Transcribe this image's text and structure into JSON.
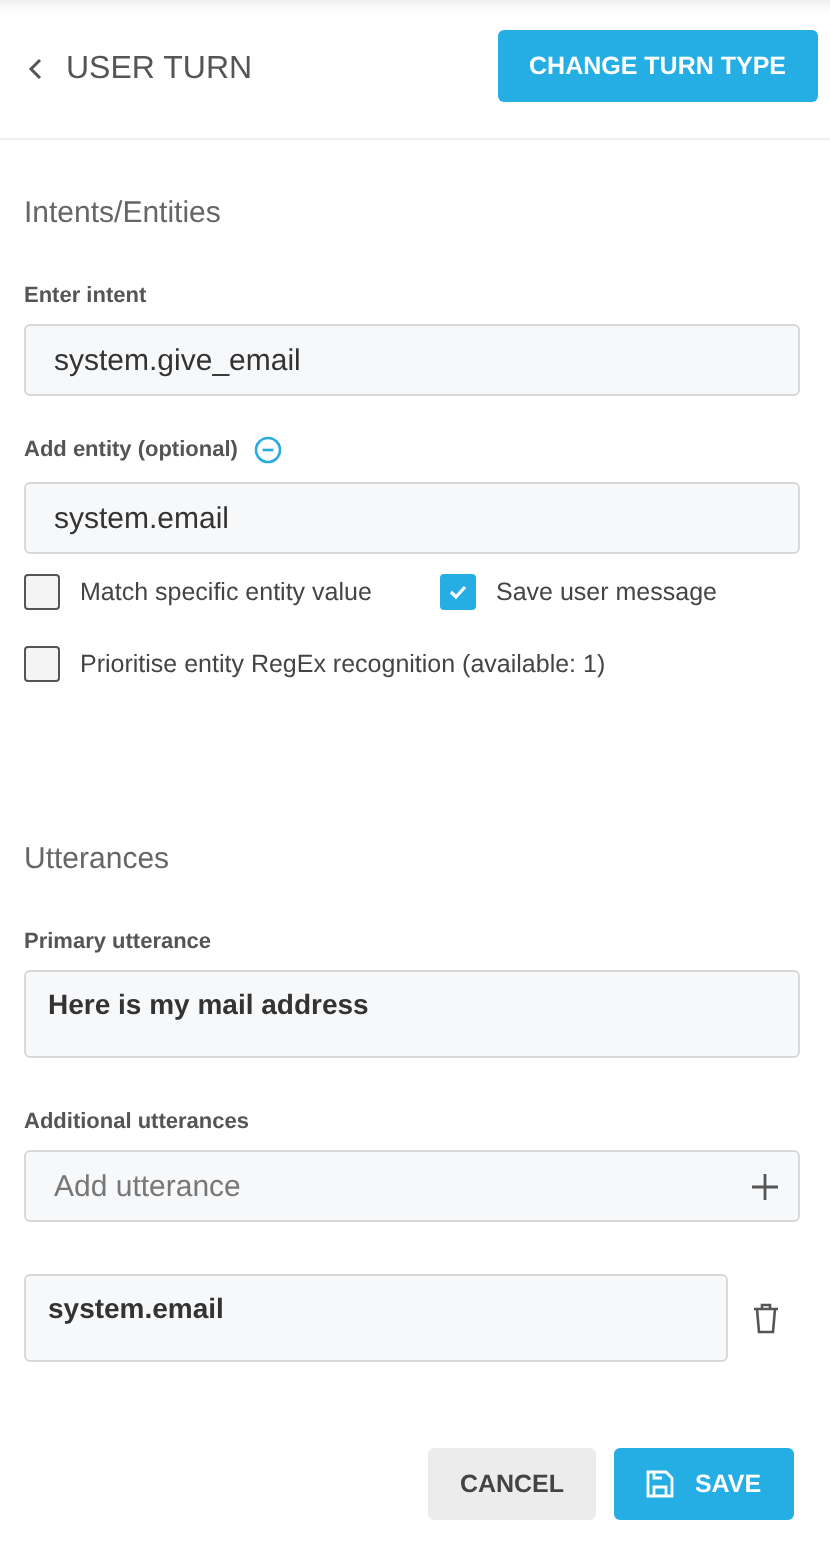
{
  "header": {
    "title": "USER TURN",
    "action_button": "CHANGE TURN TYPE"
  },
  "intents_section": {
    "heading": "Intents/Entities",
    "intent": {
      "label": "Enter intent",
      "value": "system.give_email"
    },
    "entity": {
      "label": "Add entity (optional)",
      "value": "system.email"
    },
    "checkboxes": [
      {
        "label": "Match specific entity value",
        "checked": false
      },
      {
        "label": "Save user message",
        "checked": true
      },
      {
        "label": "Prioritise entity RegEx recognition (available: 1)",
        "checked": false
      }
    ]
  },
  "utterances_section": {
    "heading": "Utterances",
    "primary": {
      "label": "Primary utterance",
      "value": "Here is my mail address"
    },
    "additional": {
      "label": "Additional utterances",
      "placeholder": "Add utterance"
    },
    "items": [
      {
        "value": "system.email"
      }
    ]
  },
  "buttons": [
    {
      "label": "CANCEL",
      "kind": "secondary"
    },
    {
      "label": "SAVE",
      "kind": "primary"
    }
  ]
}
